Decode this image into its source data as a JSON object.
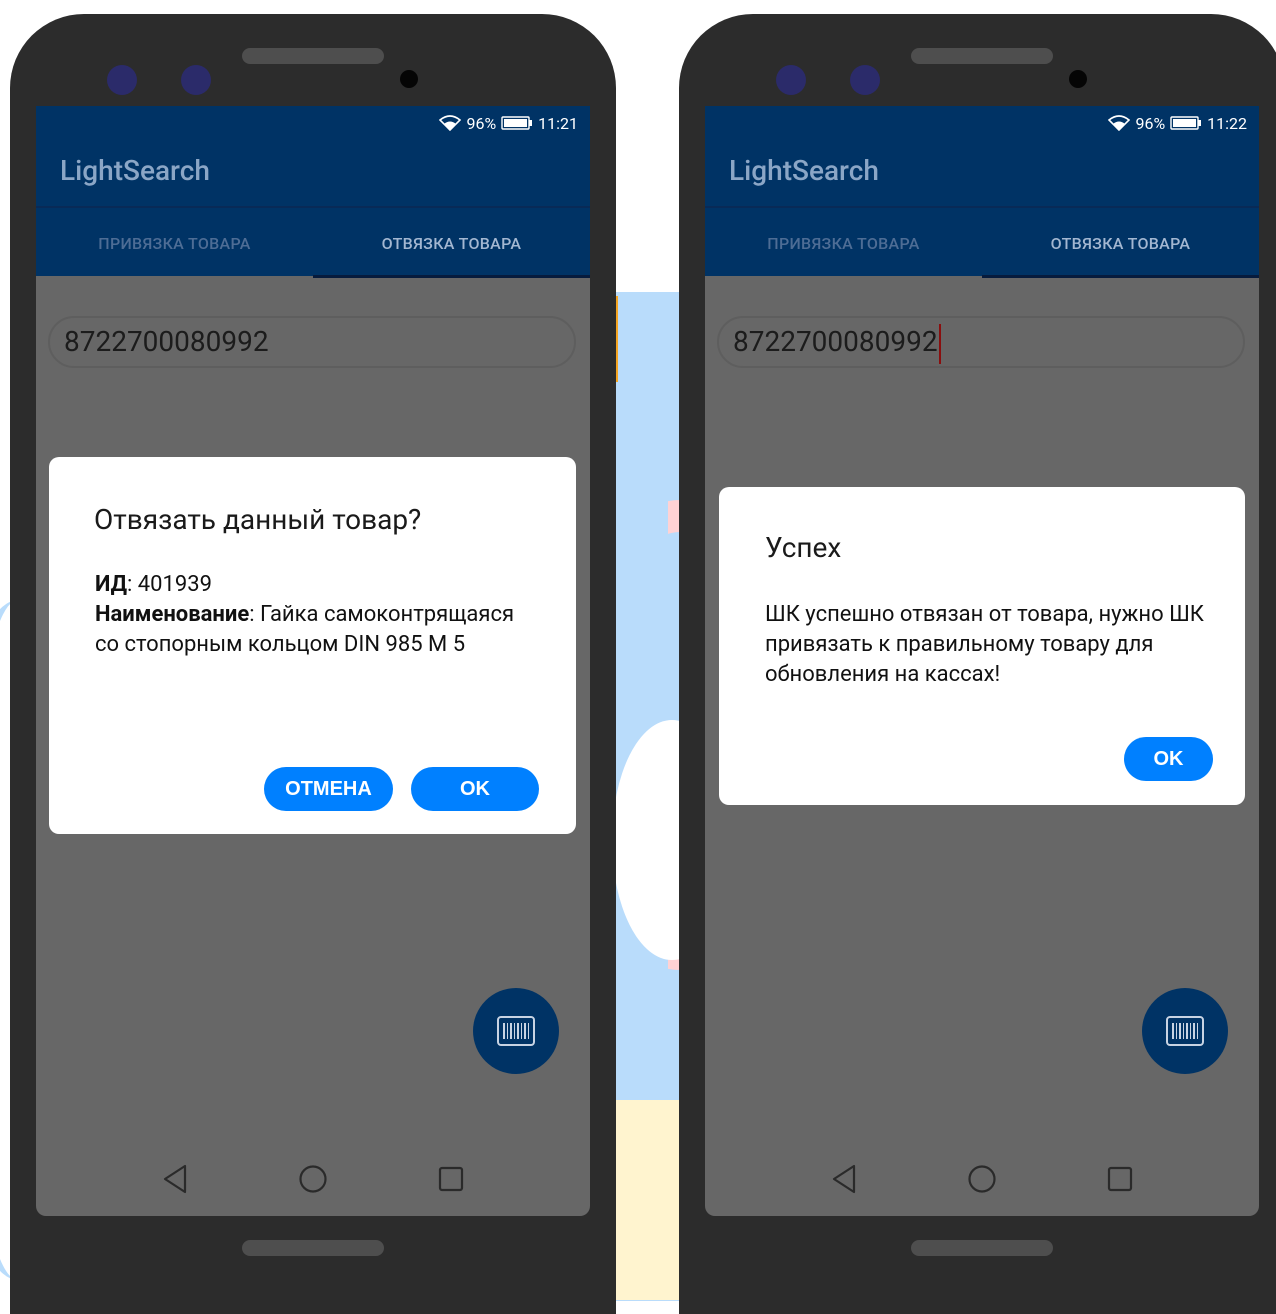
{
  "colors": {
    "app_bar": "#003365",
    "dim_overlay": "#676767",
    "button": "#0080ff",
    "cursor": "#8a0e0e"
  },
  "phones": [
    {
      "status": {
        "battery_percent": "96%",
        "time": "11:21"
      },
      "app_title": "LightSearch",
      "tabs": [
        "ПРИВЯЗКА ТОВАРА",
        "ОТВЯЗКА ТОВАРА"
      ],
      "active_tab": 1,
      "barcode_input": "8722700080992",
      "fab_icon": "barcode-icon",
      "dialog": {
        "title": "Отвязать данный товар?",
        "id_label": "ИД",
        "id_value": ": 401939",
        "name_label": "Наименование",
        "name_value": ": Гайка самоконтрящаяся со стопорным кольцом DIN 985 M 5",
        "cancel_label": "ОТМЕНА",
        "ok_label": "OK"
      }
    },
    {
      "status": {
        "battery_percent": "96%",
        "time": "11:22"
      },
      "app_title": "LightSearch",
      "tabs": [
        "ПРИВЯЗКА ТОВАРА",
        "ОТВЯЗКА ТОВАРА"
      ],
      "active_tab": 1,
      "barcode_input": "8722700080992",
      "fab_icon": "barcode-icon",
      "dialog": {
        "title": "Успех",
        "message": "ШК успешно отвязан от товара, нужно ШК привязать к правильному товару для обновления на кассах!",
        "ok_label": "OK"
      }
    }
  ],
  "nav_icons": [
    "back-icon",
    "home-icon",
    "recents-icon"
  ]
}
